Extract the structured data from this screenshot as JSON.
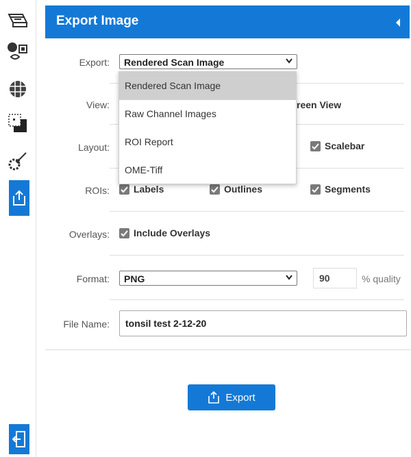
{
  "panel": {
    "title": "Export Image"
  },
  "export": {
    "label": "Export:",
    "value": "Rendered Scan Image"
  },
  "view": {
    "label": "View:",
    "visible_option": "reen View"
  },
  "layout": {
    "label": "Layout:",
    "scalebar": "Scalebar"
  },
  "rois": {
    "label": "ROIs:",
    "labels": "Labels",
    "outlines": "Outlines",
    "segments": "Segments"
  },
  "overlays": {
    "label": "Overlays:",
    "include": "Include Overlays"
  },
  "format": {
    "label": "Format:",
    "value": "PNG",
    "quality": "90",
    "quality_label": "% quality"
  },
  "file_name": {
    "label": "File Name:",
    "value": "tonsil test 2-12-20"
  },
  "actions": {
    "export_label": "Export"
  },
  "dropdown": {
    "items": [
      "Rendered Scan Image",
      "Raw Channel Images",
      "ROI Report",
      "OME-Tiff"
    ],
    "selected": "Rendered Scan Image"
  },
  "toolbar": {
    "icons": [
      "scanner-icon",
      "shapes-icon",
      "grid-sphere-icon",
      "layers-icon",
      "gear-brush-icon",
      "export-icon"
    ],
    "bottom": "exit-door-icon",
    "accent": "#1479d6"
  }
}
